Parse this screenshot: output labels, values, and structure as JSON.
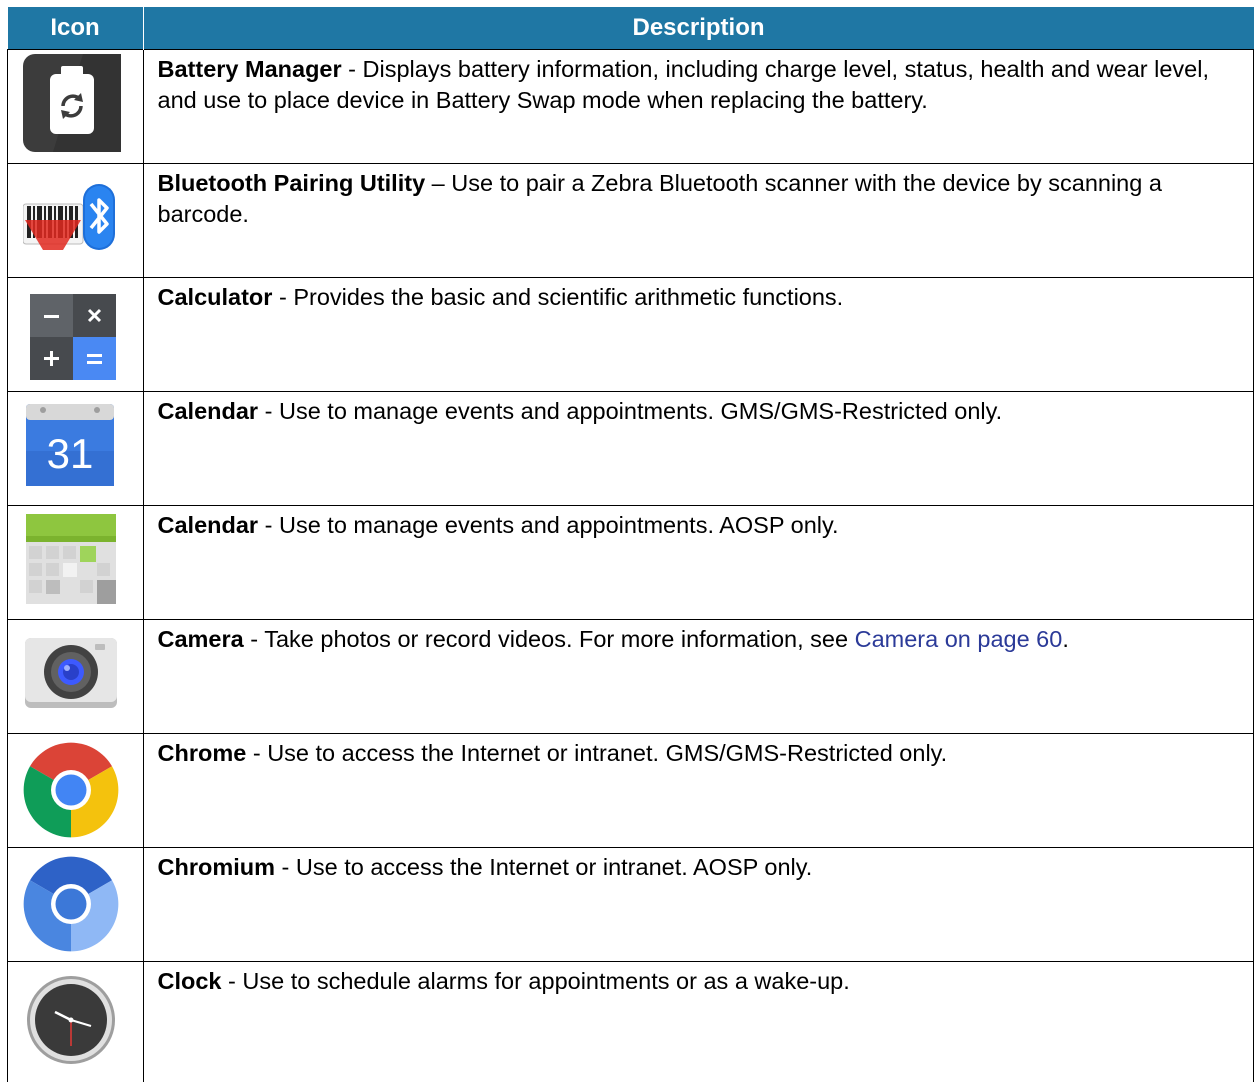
{
  "table": {
    "headers": {
      "icon": "Icon",
      "description": "Description"
    },
    "rows": [
      {
        "icon": "battery-manager-icon",
        "name": "Battery Manager",
        "sep": " - ",
        "text": "Displays battery information, including charge level, status, health and wear level, and use to place device in Battery Swap mode when replacing the battery."
      },
      {
        "icon": "bluetooth-pairing-icon",
        "name": "Bluetooth Pairing Utility",
        "sep": " – ",
        "text": "Use to pair a Zebra Bluetooth scanner with the device by scanning a barcode."
      },
      {
        "icon": "calculator-icon",
        "name": "Calculator",
        "sep": " - ",
        "text": "Provides the basic and scientific arithmetic functions."
      },
      {
        "icon": "google-calendar-icon",
        "icon_text": "31",
        "name": "Calendar",
        "sep": " - ",
        "text": "Use to manage events and appointments. GMS/GMS-Restricted only."
      },
      {
        "icon": "aosp-calendar-icon",
        "name": "Calendar",
        "sep": " - ",
        "text": "Use to manage events and appointments. AOSP only."
      },
      {
        "icon": "camera-icon",
        "name": "Camera",
        "sep": " - ",
        "text": "Take photos or record videos. For more information, see ",
        "link": "Camera on page 60",
        "after": "."
      },
      {
        "icon": "chrome-icon",
        "name": "Chrome",
        "sep": " - ",
        "text": "Use to access the Internet or intranet. GMS/GMS-Restricted only."
      },
      {
        "icon": "chromium-icon",
        "name": "Chromium",
        "sep": " - ",
        "text": "Use to access the Internet or intranet. AOSP only."
      },
      {
        "icon": "clock-icon",
        "name": "Clock",
        "sep": " - ",
        "text": "Use to schedule alarms for appointments or as a wake-up."
      }
    ]
  },
  "colors": {
    "header_bg": "#1f77a4",
    "header_text": "#ffffff",
    "link": "#2b3a98"
  }
}
